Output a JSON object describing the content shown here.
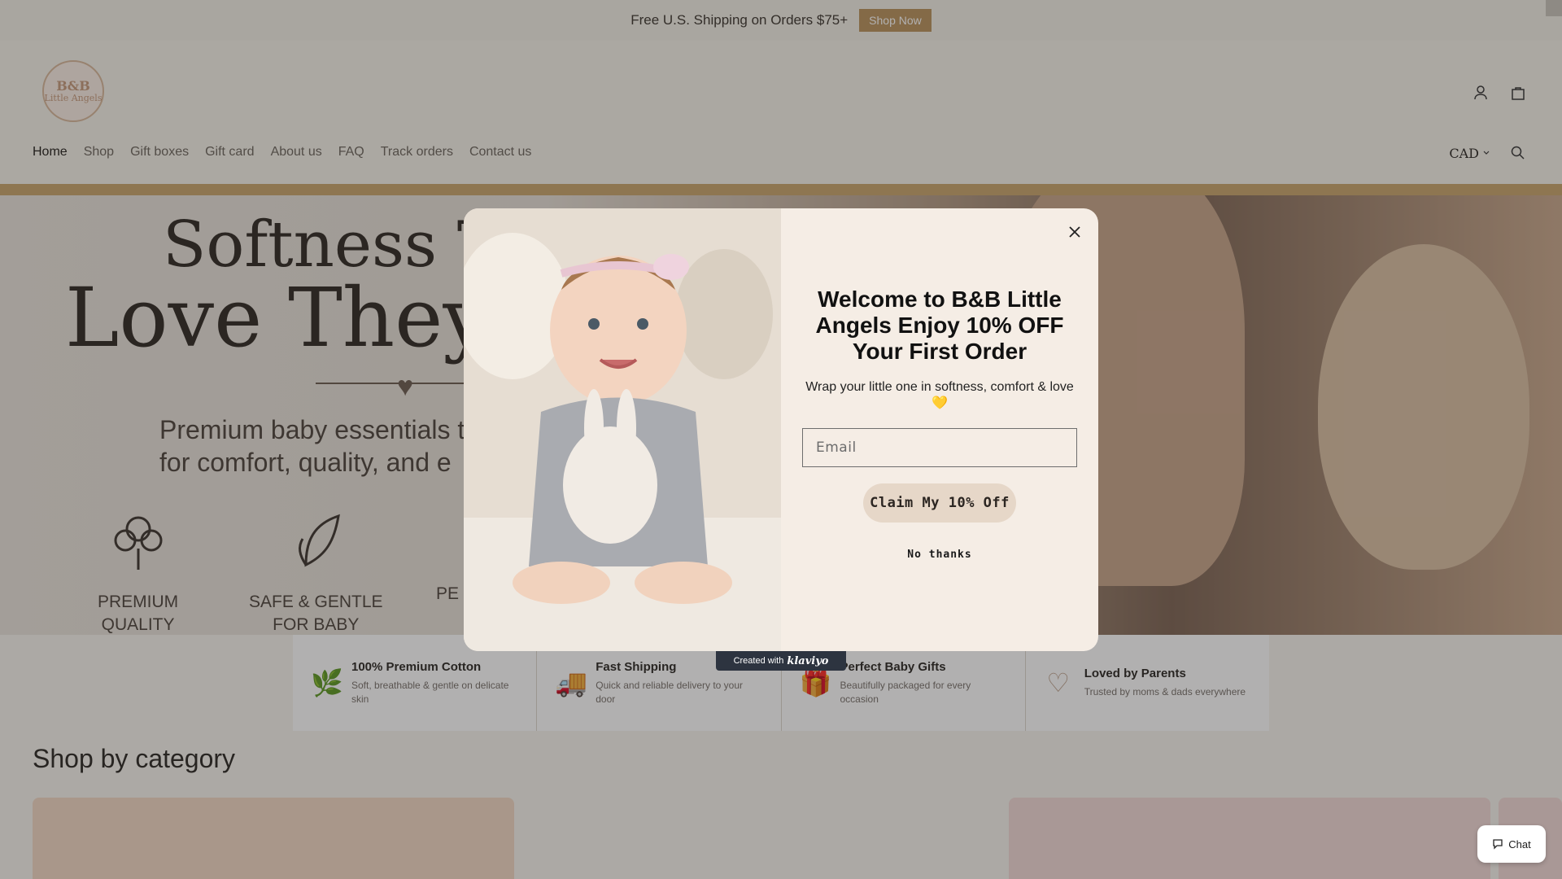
{
  "announcement": {
    "text": "Free U.S. Shipping on Orders $75+",
    "cta": "Shop Now"
  },
  "header": {
    "logo_line1": "B&B",
    "logo_line2": "Little Angels",
    "nav": [
      "Home",
      "Shop",
      "Gift boxes",
      "Gift card",
      "About us",
      "FAQ",
      "Track orders",
      "Contact us"
    ],
    "currency": "CAD",
    "icons": [
      "account-icon",
      "cart-icon",
      "search-icon"
    ]
  },
  "hero": {
    "line1": "Softness Th",
    "line2": "Love They",
    "sub_line1": "Premium baby essentials t",
    "sub_line2": "for comfort, quality, and e",
    "features": [
      {
        "l1": "PREMIUM",
        "l2": "QUALITY"
      },
      {
        "l1": "SAFE & GENTLE",
        "l2": "FOR BABY"
      },
      {
        "l1": "PE",
        "l2": ""
      }
    ]
  },
  "strip": [
    {
      "icon": "🌿",
      "title": "100% Premium Cotton",
      "desc": "Soft, breathable & gentle on delicate skin"
    },
    {
      "icon": "🚚",
      "title": "Fast Shipping",
      "desc": "Quick and reliable delivery to your door"
    },
    {
      "icon": "🎁",
      "title": "Perfect Baby Gifts",
      "desc": "Beautifully packaged for every occasion"
    },
    {
      "icon": "♡",
      "title": "Loved by Parents",
      "desc": "Trusted by moms & dads everywhere"
    }
  ],
  "section": {
    "shop_by_category": "Shop by category"
  },
  "modal": {
    "title": "Welcome to B&B Little Angels Enjoy 10% OFF Your First Order",
    "subtitle": "Wrap your little one in softness, comfort & love 💛",
    "email_placeholder": "Email",
    "claim": "Claim My 10% Off",
    "no_thanks": "No thanks",
    "created_with": "Created with",
    "brand": "klaviyo"
  },
  "chat": {
    "label": "Chat"
  },
  "colors": {
    "accent": "#b9925b",
    "modal_bg": "#f5ede5",
    "claim_bg": "#e6d7c8",
    "rule": "#c9a46b"
  }
}
